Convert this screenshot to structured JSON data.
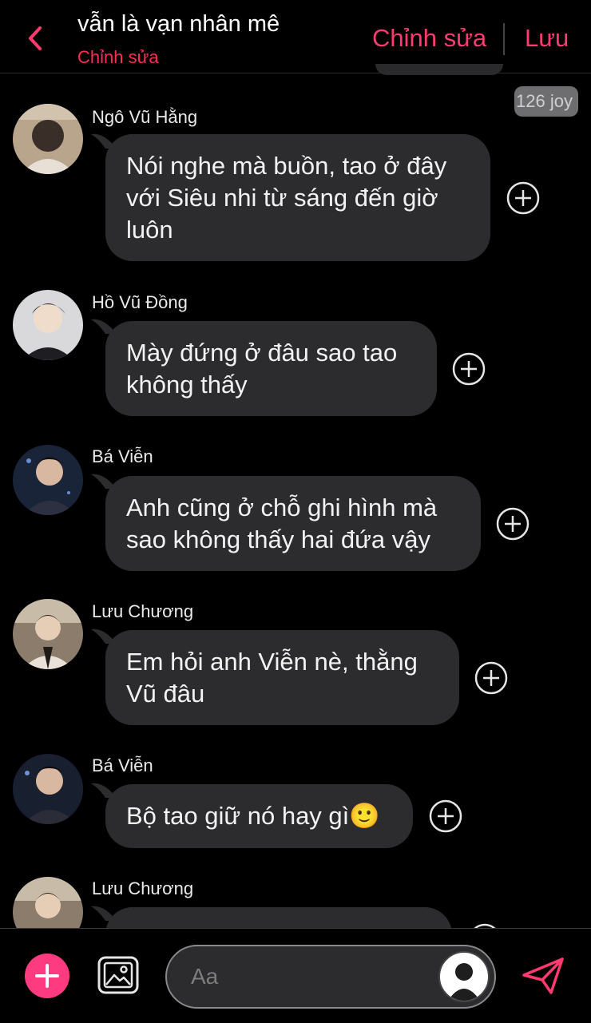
{
  "header": {
    "title": "vẫn là vạn nhân mê",
    "subtitle": "Chỉnh sửa",
    "edit_label": "Chỉnh sửa",
    "save_label": "Lưu"
  },
  "joy_badge": "126 joy",
  "messages": [
    {
      "sender": "Ngô Vũ Hằng",
      "text": "Nói nghe mà buồn, tao ở đây với Siêu nhi từ sáng đến giờ luôn"
    },
    {
      "sender": "Hồ Vũ Đồng",
      "text": "Mày đứng ở đâu sao tao không thấy"
    },
    {
      "sender": "Bá Viễn",
      "text": "Anh cũng ở chỗ ghi hình mà sao không thấy hai đứa vậy"
    },
    {
      "sender": "Lưu Chương",
      "text": "Em hỏi anh Viễn nè, thằng Vũ đâu"
    },
    {
      "sender": "Bá Viễn",
      "text": "Bộ tao giữ nó hay gì🙂"
    },
    {
      "sender": "Lưu Chương",
      "text": ""
    }
  ],
  "composer": {
    "placeholder": "Aa"
  },
  "colors": {
    "accent": "#ff3b6f",
    "bubble": "#2c2c2e",
    "background": "#000000"
  },
  "icons": [
    "back-chevron-icon",
    "add-reaction-icon",
    "plus-icon",
    "image-icon",
    "avatar-icon",
    "send-icon"
  ]
}
